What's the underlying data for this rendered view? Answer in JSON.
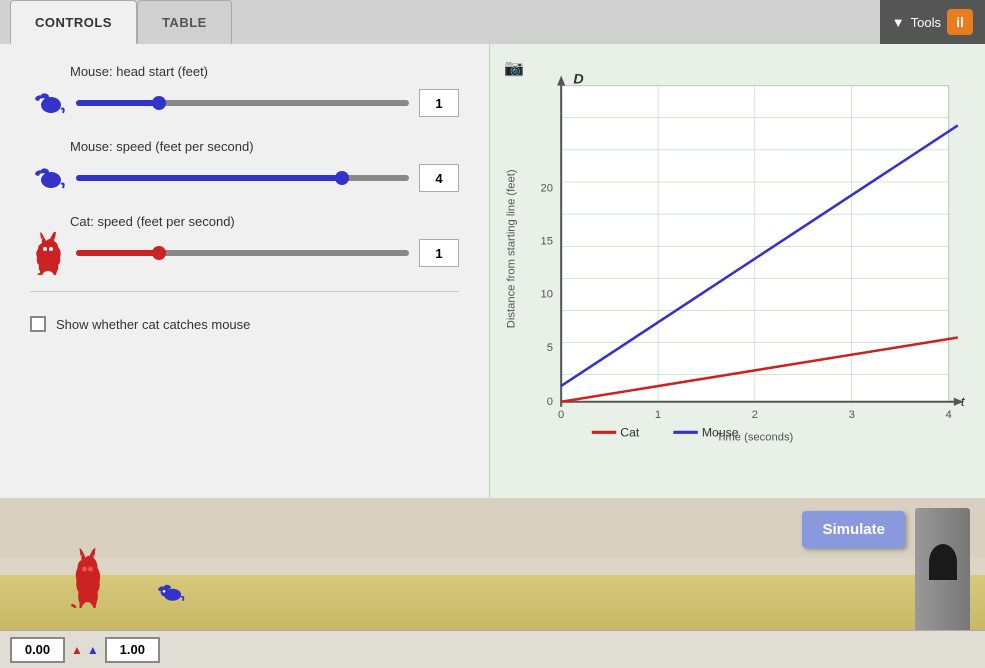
{
  "tabs": {
    "controls_label": "CONTROLS",
    "table_label": "TABLE"
  },
  "tools": {
    "label": "Tools",
    "icon_label": "il"
  },
  "controls": {
    "mouse_headstart_label": "Mouse: head start (feet)",
    "mouse_speed_label": "Mouse: speed (feet per second)",
    "cat_speed_label": "Cat: speed (feet per second)",
    "mouse_headstart_value": "1",
    "mouse_speed_value": "4",
    "cat_speed_value": "1",
    "mouse_headstart_pct": 25,
    "mouse_speed_pct": 80,
    "cat_speed_pct": 25,
    "checkbox_label": "Show whether cat catches mouse"
  },
  "chart": {
    "y_axis_label": "Distance from starting line (feet)",
    "x_axis_label": "Time (seconds)",
    "y_axis_title": "D",
    "t_label": "t",
    "y_max": 20,
    "x_max": 4,
    "legend_cat": "Cat",
    "legend_mouse": "Mouse"
  },
  "simulation": {
    "simulate_button": "Simulate",
    "cat_position": "0.00",
    "mouse_position": "1.00"
  }
}
